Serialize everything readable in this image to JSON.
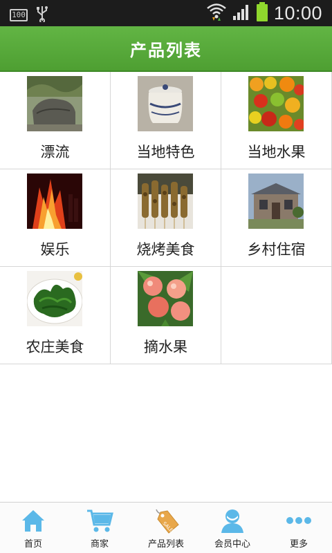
{
  "status_bar": {
    "battery_small": "100",
    "time": "10:00"
  },
  "header": {
    "title": "产品列表"
  },
  "products": [
    {
      "label": "漂流",
      "image": "rocks-river-photo"
    },
    {
      "label": "当地特色",
      "image": "ceramic-jar-photo"
    },
    {
      "label": "当地水果",
      "image": "fruit-pile-photo"
    },
    {
      "label": "娱乐",
      "image": "bonfire-night-photo"
    },
    {
      "label": "烧烤美食",
      "image": "bbq-skewers-photo"
    },
    {
      "label": "乡村住宿",
      "image": "country-house-photo"
    },
    {
      "label": "农庄美食",
      "image": "greens-dish-photo"
    },
    {
      "label": "摘水果",
      "image": "peaches-photo"
    }
  ],
  "bottom_nav": [
    {
      "label": "首页",
      "icon": "home-icon"
    },
    {
      "label": "商家",
      "icon": "cart-icon"
    },
    {
      "label": "产品列表",
      "icon": "tag-icon"
    },
    {
      "label": "会员中心",
      "icon": "user-icon"
    },
    {
      "label": "更多",
      "icon": "more-icon"
    }
  ],
  "colors": {
    "header_green": "#56a93a",
    "nav_icon_blue": "#5bb8e8",
    "tag_orange": "#e8a74a"
  }
}
